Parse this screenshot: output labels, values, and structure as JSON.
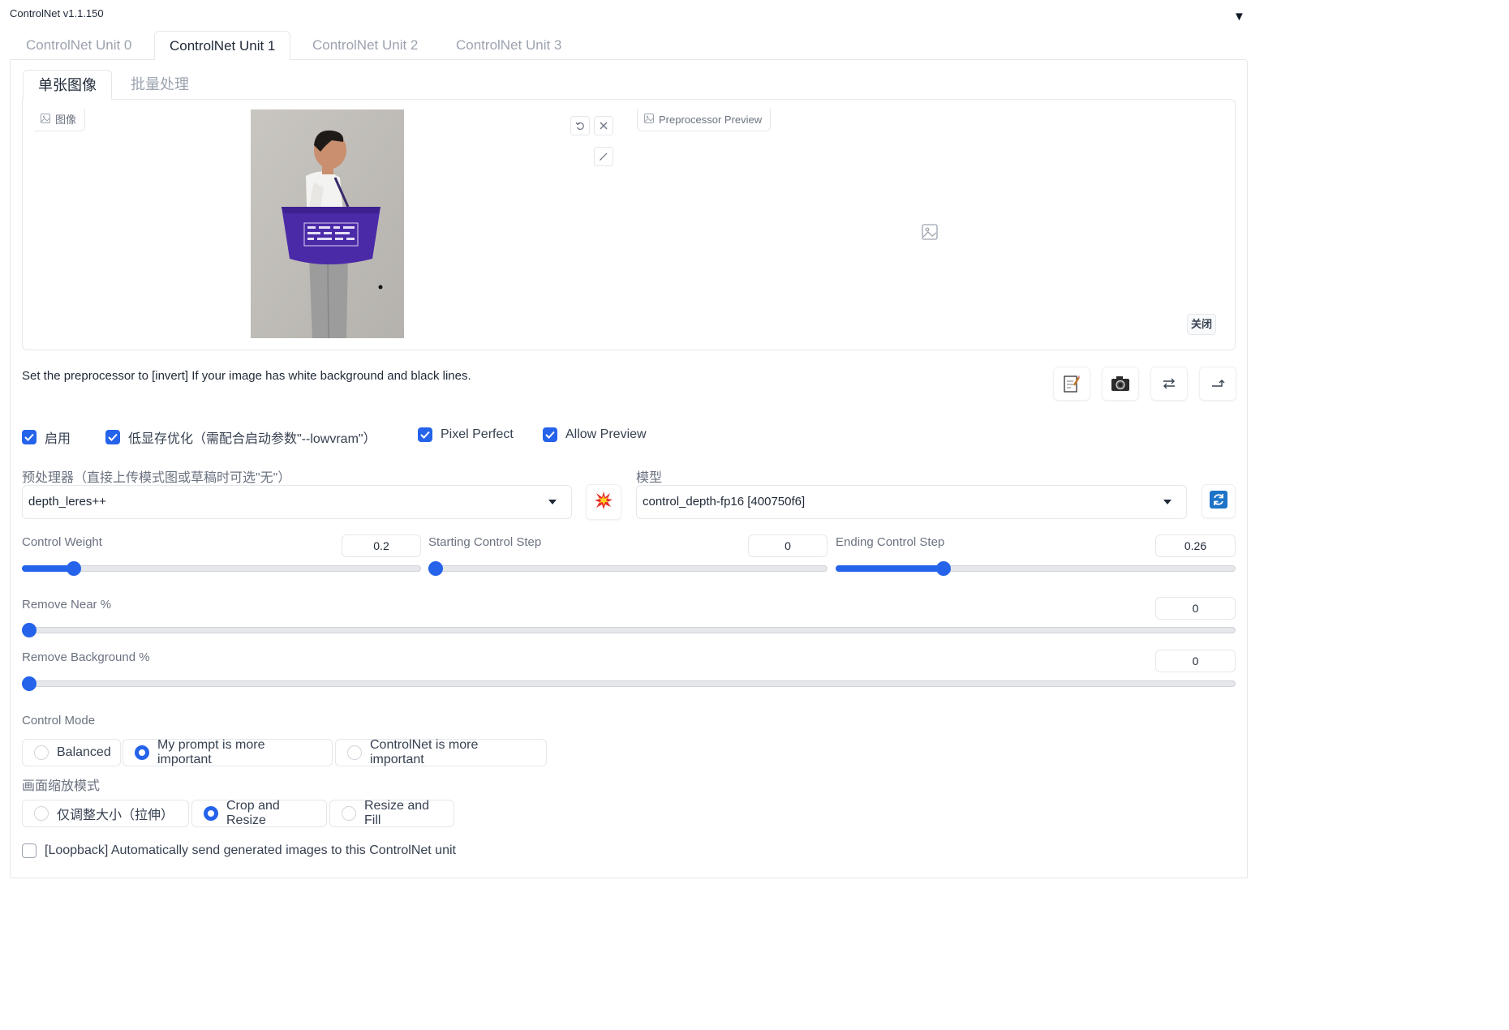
{
  "app": {
    "title": "ControlNet v1.1.150",
    "collapse_glyph": "▼"
  },
  "unit_tabs": [
    "ControlNet Unit 0",
    "ControlNet Unit 1",
    "ControlNet Unit 2",
    "ControlNet Unit 3"
  ],
  "active_unit_tab": 1,
  "input_tabs": [
    "单张图像",
    "批量处理"
  ],
  "image_panel": {
    "label": "图像",
    "icons": [
      "undo-icon",
      "close-icon",
      "brush-icon"
    ]
  },
  "preview_panel": {
    "label": "Preprocessor Preview",
    "placeholder_icon": "image-icon",
    "close_label": "关闭"
  },
  "info_text": "Set the preprocessor to [invert] If your image has white background and black lines.",
  "tool_icons": [
    "edit-note-icon",
    "camera-icon",
    "swap-icon",
    "send-dimensions-icon"
  ],
  "checkboxes": {
    "enable": {
      "label": "启用",
      "checked": true
    },
    "low_vram": {
      "label": "低显存优化（需配合启动参数\"--lowvram\"）",
      "checked": true
    },
    "pixel_perfect": {
      "label": "Pixel Perfect",
      "checked": true
    },
    "allow_preview": {
      "label": "Allow Preview",
      "checked": true
    }
  },
  "preprocessor": {
    "label": "预处理器（直接上传模式图或草稿时可选\"无\"）",
    "value": "depth_leres++",
    "run_icon": "explosion-icon"
  },
  "model": {
    "label": "模型",
    "value": "control_depth-fp16 [400750f6]",
    "refresh_icon": "refresh-icon"
  },
  "sliders": {
    "control_weight": {
      "label": "Control Weight",
      "value": "0.2",
      "fraction": 0.115
    },
    "starting_step": {
      "label": "Starting Control Step",
      "value": "0",
      "fraction": 0.0
    },
    "ending_step": {
      "label": "Ending Control Step",
      "value": "0.26",
      "fraction": 0.26
    },
    "remove_near": {
      "label": "Remove Near %",
      "value": "0",
      "fraction": 0.0
    },
    "remove_background": {
      "label": "Remove Background %",
      "value": "0",
      "fraction": 0.0
    }
  },
  "control_mode": {
    "label": "Control Mode",
    "options": [
      "Balanced",
      "My prompt is more important",
      "ControlNet is more important"
    ],
    "selected": 1
  },
  "resize_mode": {
    "label": "画面缩放模式",
    "options": [
      "仅调整大小（拉伸）",
      "Crop and Resize",
      "Resize and Fill"
    ],
    "selected": 1
  },
  "loopback": {
    "label": "[Loopback] Automatically send generated images to this ControlNet unit",
    "checked": false
  },
  "colors": {
    "accent": "#2563eb",
    "bag": "#4b2aa8"
  }
}
